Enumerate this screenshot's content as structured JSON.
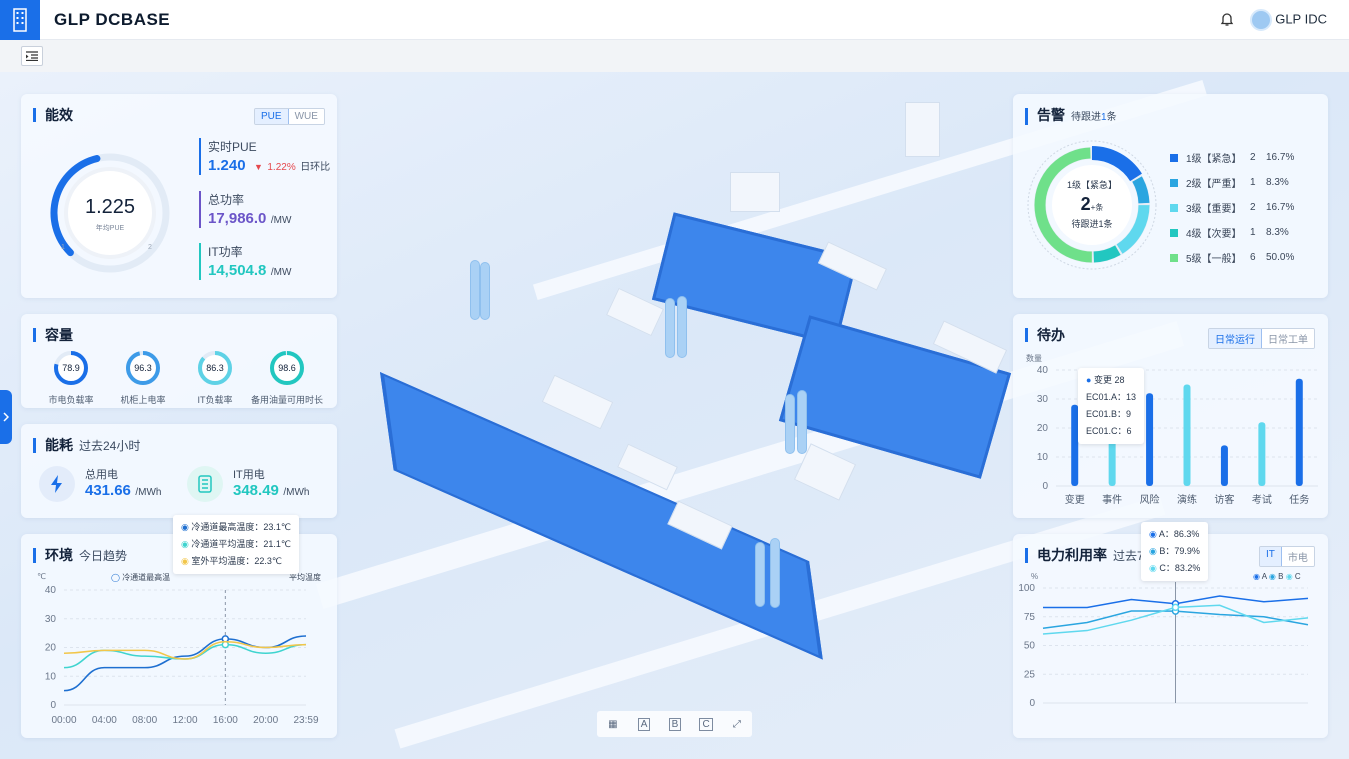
{
  "header": {
    "brand": "GLP DCBASE",
    "user": "GLP IDC"
  },
  "icons": {
    "logo": "building-logo-icon",
    "bell": "bell-icon",
    "menu": "menu-indent-icon",
    "expand": "chevron-right-icon",
    "fullscreen": "fullscreen-icon"
  },
  "colors": {
    "accent": "#1a6fe8",
    "teal": "#22c7c0",
    "purple": "#6b55c8",
    "red": "#e5484d"
  },
  "efficiency": {
    "title": "能效",
    "tabs": [
      "PUE",
      "WUE"
    ],
    "active_tab": "PUE",
    "gauge_value": "1.225",
    "gauge_label": "年均PUE",
    "gauge_fraction": 0.45,
    "gauge_tick_left": "1",
    "gauge_tick_right": "2",
    "realtime_label": "实时PUE",
    "realtime_value": "1.240",
    "change": "1.22%",
    "change_label": "日环比",
    "power_label": "总功率",
    "power_value": "17,986.0",
    "power_unit": "/MW",
    "it_label": "IT功率",
    "it_value": "14,504.8",
    "it_unit": "/MW"
  },
  "capacity": {
    "title": "容量",
    "items": [
      {
        "value": "78.9",
        "label": "市电负载率",
        "fraction": 0.789,
        "color": "#1a6fe8"
      },
      {
        "value": "96.3",
        "label": "机柜上电率",
        "fraction": 0.963,
        "color": "#3d9be8"
      },
      {
        "value": "86.3",
        "label": "IT负载率",
        "fraction": 0.863,
        "color": "#5ed2e6"
      },
      {
        "value": "98.6",
        "label": "备用油量可用时长",
        "fraction": 0.986,
        "color": "#22c7c0"
      }
    ]
  },
  "energy": {
    "title": "能耗",
    "subtitle": "过去24小时",
    "total_label": "总用电",
    "total_value": "431.66",
    "total_unit": "/MWh",
    "it_label": "IT用电",
    "it_value": "348.49",
    "it_unit": "/MWh"
  },
  "environment": {
    "title": "环境",
    "subtitle": "今日趋势",
    "unit": "℃",
    "legend_left": "冷通道最高温",
    "legend_right": "平均温度",
    "tooltip": [
      "冷通道最高温度：23.1℃",
      "冷通道平均温度：21.1℃",
      "室外平均温度：22.3℃"
    ]
  },
  "alarm": {
    "title": "告警",
    "subtitle_prefix": "待跟进",
    "subtitle_count": "1",
    "subtitle_suffix": "条",
    "center_label": "1级【紧急】",
    "center_value": "2",
    "center_unit": "+条",
    "center_sub": "待跟进1条",
    "levels": [
      {
        "name": "1级【紧急】",
        "count": "2",
        "pct": "16.7%",
        "color": "#1a6fe8"
      },
      {
        "name": "2级【严重】",
        "count": "1",
        "pct": "8.3%",
        "color": "#2aa5e0"
      },
      {
        "name": "3级【重要】",
        "count": "2",
        "pct": "16.7%",
        "color": "#5fd8ee"
      },
      {
        "name": "4级【次要】",
        "count": "1",
        "pct": "8.3%",
        "color": "#22c7c0"
      },
      {
        "name": "5级【一般】",
        "count": "6",
        "pct": "50.0%",
        "color": "#6fe08a"
      }
    ]
  },
  "todo": {
    "title": "待办",
    "tabs": [
      "日常运行",
      "日常工单"
    ],
    "ylabel": "数量",
    "tooltip": [
      "变更  28",
      "EC01.A：13",
      "EC01.B：9",
      "EC01.C：6"
    ]
  },
  "power_util": {
    "title": "电力利用率",
    "subtitle": "过去7",
    "unit": "%",
    "tabs": [
      "IT",
      "市电"
    ],
    "legend": [
      "A",
      "B",
      "C"
    ],
    "tooltip": [
      "A：86.3%",
      "B：79.9%",
      "C：83.2%"
    ]
  },
  "chart_data": [
    {
      "type": "line",
      "title": "环境",
      "ylabel": "℃",
      "ylim": [
        0,
        40
      ],
      "yticks": [
        0,
        10,
        20,
        30,
        40
      ],
      "x": [
        "00:00",
        "04:00",
        "08:00",
        "12:00",
        "16:00",
        "20:00",
        "23:59"
      ],
      "series": [
        {
          "name": "冷通道最高温",
          "color": "#1e6fd0",
          "values": [
            5,
            13,
            13,
            17,
            23,
            20,
            24
          ]
        },
        {
          "name": "冷通道平均温度",
          "color": "#3fd4cf",
          "values": [
            13,
            19,
            17,
            16,
            21,
            18,
            21
          ]
        },
        {
          "name": "室外平均温度",
          "color": "#f2c64a",
          "values": [
            18,
            19,
            19,
            16,
            22,
            20,
            21
          ]
        }
      ]
    },
    {
      "type": "bar",
      "title": "待办",
      "ylabel": "数量",
      "ylim": [
        0,
        40
      ],
      "yticks": [
        0,
        10,
        20,
        30,
        40
      ],
      "categories": [
        "变更",
        "事件",
        "风险",
        "演练",
        "访客",
        "考试",
        "任务"
      ],
      "values": [
        28,
        20,
        32,
        35,
        14,
        22,
        37
      ],
      "colors": [
        "#1a6fe8",
        "#5fd8ee",
        "#1a6fe8",
        "#5fd8ee",
        "#1a6fe8",
        "#5fd8ee",
        "#1a6fe8"
      ]
    },
    {
      "type": "line",
      "title": "电力利用率",
      "ylabel": "%",
      "ylim": [
        0,
        100
      ],
      "yticks": [
        0,
        25,
        50,
        75,
        100
      ],
      "x": [
        1,
        2,
        3,
        4,
        5,
        6,
        7
      ],
      "series": [
        {
          "name": "A",
          "color": "#1a6fe8",
          "values": [
            83,
            83,
            90,
            86.3,
            93,
            88,
            91
          ]
        },
        {
          "name": "B",
          "color": "#2aa5e0",
          "values": [
            65,
            70,
            80,
            79.9,
            77,
            75,
            68
          ]
        },
        {
          "name": "C",
          "color": "#5fd8ee",
          "values": [
            60,
            63,
            72,
            83.2,
            85,
            70,
            74
          ]
        }
      ]
    }
  ]
}
